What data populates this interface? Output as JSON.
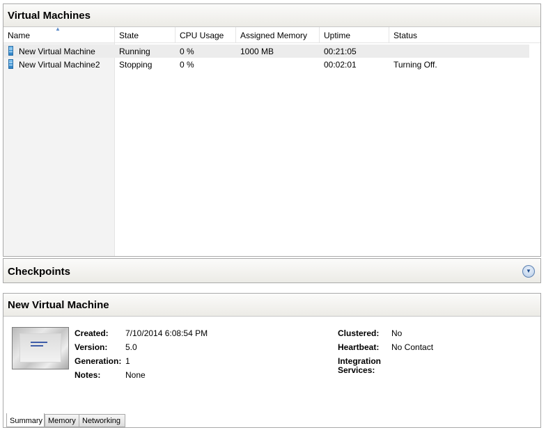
{
  "vm_panel": {
    "title": "Virtual Machines",
    "columns": [
      "Name",
      "State",
      "CPU Usage",
      "Assigned Memory",
      "Uptime",
      "Status"
    ],
    "rows": [
      {
        "name": "New Virtual Machine",
        "state": "Running",
        "cpu": "0 %",
        "memory": "1000 MB",
        "uptime": "00:21:05",
        "status": ""
      },
      {
        "name": "New Virtual Machine2",
        "state": "Stopping",
        "cpu": "0 %",
        "memory": "",
        "uptime": "00:02:01",
        "status": "Turning Off."
      }
    ]
  },
  "checkpoints": {
    "title": "Checkpoints"
  },
  "details": {
    "title": "New Virtual Machine",
    "created_label": "Created:",
    "created_value": "7/10/2014 6:08:54 PM",
    "version_label": "Version:",
    "version_value": "5.0",
    "generation_label": "Generation:",
    "generation_value": "1",
    "notes_label": "Notes:",
    "notes_value": "None",
    "clustered_label": "Clustered:",
    "clustered_value": "No",
    "heartbeat_label": "Heartbeat:",
    "heartbeat_value": "No Contact",
    "integration_label_1": "Integration",
    "integration_label_2": "Services:",
    "tabs": [
      "Summary",
      "Memory",
      "Networking"
    ]
  }
}
